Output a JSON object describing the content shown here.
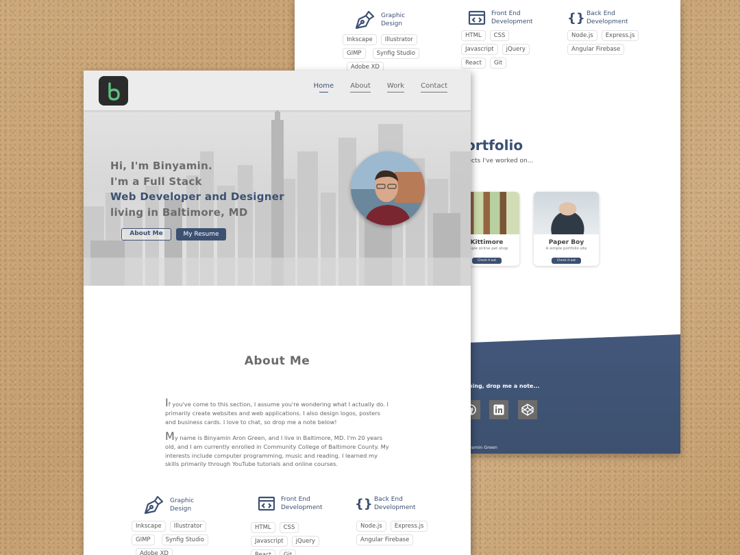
{
  "back_page": {
    "skills": [
      {
        "title_line1": "Graphic",
        "title_line2": "Design",
        "icon": "pen-nib-icon",
        "chips": [
          "Inkscape",
          "Illustrator",
          "GIMP",
          "Synfig Studio",
          "Adobe XD"
        ]
      },
      {
        "title_line1": "Front End",
        "title_line2": "Development",
        "icon": "code-window-icon",
        "chips": [
          "HTML",
          "CSS",
          "Javascript",
          "jQuery",
          "React",
          "Git"
        ]
      },
      {
        "title_line1": "Back End",
        "title_line2": "Development",
        "icon": "curly-braces-icon",
        "chips": [
          "Node.js",
          "Express.js",
          "Angular Firebase"
        ]
      }
    ],
    "portfolio_title": "ortfolio",
    "portfolio_subtitle": "jects I've worked on...",
    "cards": [
      {
        "title": "Kittimore",
        "desc": "ample online pet shop",
        "button": "Check it out"
      },
      {
        "title": "Paper Boy",
        "desc": "A simple portfolio site",
        "button": "Check it out"
      }
    ],
    "footer_note": "thing, drop me a note...",
    "footer_copy": "nyamin Green",
    "social_icons": [
      "github-icon",
      "linkedin-icon",
      "codepen-icon"
    ]
  },
  "front_page": {
    "nav": {
      "links": [
        "Home",
        "About",
        "Work",
        "Contact"
      ],
      "active": "Home",
      "logo_icon": "b-logo-icon"
    },
    "hero": {
      "line1": "Hi, I'm Binyamin.",
      "line2": "I'm a Full Stack",
      "line3": "Web Developer and Designer",
      "line4": "living in Baltimore, MD",
      "about_button": "About Me",
      "resume_button": "My Resume"
    },
    "about": {
      "title": "About Me",
      "p1_cap": "I",
      "p1": "f you've come to this section, I assume you're wondering what I actually do. I primarily create websites and web applications. I also design logos, posters and business cards. I love to chat, so drop me a note below!",
      "p2_cap": "M",
      "p2": "y name is Binyamin Aron Green, and I live in Baltimore, MD. I'm 20 years old, and I am currently enrolled in Community College of Baltimore County. My interests include computer programming, music and reading. I learned my skills primarily through YouTube tutorials and online courses."
    },
    "skills": [
      {
        "title_line1": "Graphic",
        "title_line2": "Design",
        "chips": [
          "Inkscape",
          "Illustrator",
          "GIMP",
          "Synfig Studio",
          "Adobe XD"
        ]
      },
      {
        "title_line1": "Front End",
        "title_line2": "Development",
        "chips": [
          "HTML",
          "CSS",
          "Javascript",
          "jQuery",
          "React",
          "Git"
        ]
      },
      {
        "title_line1": "Back End",
        "title_line2": "Development",
        "chips": [
          "Node.js",
          "Express.js",
          "Angular Firebase"
        ]
      }
    ]
  },
  "colors": {
    "accent": "#3c5072",
    "text_gray": "#6b6b6b",
    "nav_bg": "#ececec",
    "footer_bg": "#3f5170"
  }
}
